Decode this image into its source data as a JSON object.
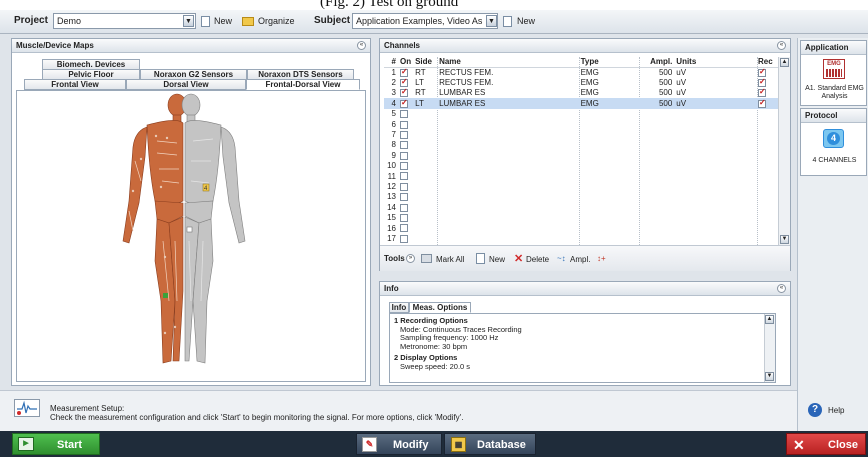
{
  "caption": "(Fig. 2) Test on ground",
  "topbar": {
    "project_label": "Project",
    "project_value": "Demo",
    "new_label": "New",
    "organize_label": "Organize",
    "subject_label": "Subject",
    "subject_value": "Application Examples, Video As",
    "subject_new_label": "New"
  },
  "muscle_panel": {
    "title": "Muscle/Device Maps",
    "tabs_row1": [
      "Biomech. Devices"
    ],
    "tabs_row2": [
      "Pelvic Floor",
      "Noraxon G2 Sensors",
      "Noraxon DTS Sensors"
    ],
    "tabs_row3": [
      "Frontal View",
      "Dorsal View",
      "Frontal-Dorsal View"
    ],
    "sensor_labels": [
      "4"
    ]
  },
  "channels": {
    "title": "Channels",
    "headers": [
      "#",
      "On",
      "Side",
      "Name",
      "Type",
      "Ampl.",
      "Units",
      "Rec"
    ],
    "rows": [
      {
        "n": "1",
        "on": true,
        "side": "RT",
        "name": "RECTUS FEM.",
        "type": "EMG",
        "ampl": "500",
        "units": "uV",
        "rec": true
      },
      {
        "n": "2",
        "on": true,
        "side": "LT",
        "name": "RECTUS FEM.",
        "type": "EMG",
        "ampl": "500",
        "units": "uV",
        "rec": true
      },
      {
        "n": "3",
        "on": true,
        "side": "RT",
        "name": "LUMBAR ES",
        "type": "EMG",
        "ampl": "500",
        "units": "uV",
        "rec": true
      },
      {
        "n": "4",
        "on": true,
        "side": "LT",
        "name": "LUMBAR ES",
        "type": "EMG",
        "ampl": "500",
        "units": "uV",
        "rec": true
      },
      {
        "n": "5",
        "on": false
      },
      {
        "n": "6",
        "on": false
      },
      {
        "n": "7",
        "on": false
      },
      {
        "n": "8",
        "on": false
      },
      {
        "n": "9",
        "on": false
      },
      {
        "n": "10",
        "on": false
      },
      {
        "n": "11",
        "on": false
      },
      {
        "n": "12",
        "on": false
      },
      {
        "n": "13",
        "on": false
      },
      {
        "n": "14",
        "on": false
      },
      {
        "n": "15",
        "on": false
      },
      {
        "n": "16",
        "on": false
      },
      {
        "n": "17",
        "on": false
      }
    ],
    "tools": {
      "tools_label": "Tools",
      "mark_all": "Mark All",
      "new": "New",
      "delete": "Delete",
      "ampl": "Ampl."
    }
  },
  "info": {
    "title": "Info",
    "tabs": [
      "Info",
      "Meas. Options"
    ],
    "sections": [
      {
        "heading": "1 Recording Options",
        "lines": [
          "Mode: Continuous Traces Recording",
          "Sampling frequency: 1000 Hz",
          "Metronome: 30 bpm"
        ]
      },
      {
        "heading": "2 Display Options",
        "lines": [
          "Sweep speed: 20.0 s"
        ]
      }
    ]
  },
  "application": {
    "title": "Application",
    "icon_text": "EMG",
    "label_line1": "A1. Standard EMG",
    "label_line2": "Analysis"
  },
  "protocol": {
    "title": "Protocol",
    "icon_number": "4",
    "label": "4 CHANNELS"
  },
  "status": {
    "line1": "Measurement Setup:",
    "line2": "Check the measurement configuration and click 'Start' to begin monitoring the signal. For more options, click 'Modify'."
  },
  "help_label": "Help",
  "bottom": {
    "start": "Start",
    "modify": "Modify",
    "database": "Database",
    "close": "Close"
  },
  "colors": {
    "start_green": "#3aa13a",
    "close_red": "#d73030",
    "selection_blue": "#c7dbf3",
    "protocol_blue": "#2f8fdc"
  }
}
